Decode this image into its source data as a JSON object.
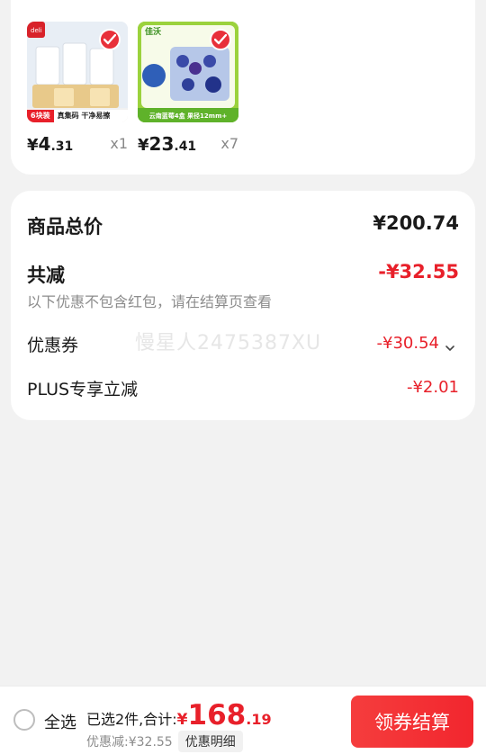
{
  "products": [
    {
      "price_symbol": "¥",
      "price_int": "4",
      "price_dec": ".31",
      "qty": "x1",
      "strip_text": [
        "6块装",
        "真集码 干净易擦"
      ]
    },
    {
      "price_symbol": "¥",
      "price_int": "23",
      "price_dec": ".41",
      "qty": "x7",
      "strip_text": [
        "云南蓝莓4盒 果径12mm+"
      ]
    }
  ],
  "summary": {
    "total_label": "商品总价",
    "total_value": "¥200.74",
    "reduce_label": "共减",
    "reduce_value": "-¥32.55",
    "reduce_note": "以下优惠不包含红包，请在结算页查看",
    "coupon_label": "优惠券",
    "coupon_value": "-¥30.54",
    "plus_label": "PLUS专享立减",
    "plus_value": "-¥2.01",
    "watermark": "慢星人2475387XU"
  },
  "bottom": {
    "select_all": "全选",
    "selected_text": "已选2件,合计:",
    "total_symbol": "¥",
    "total_int": "168",
    "total_dec": ".19",
    "discount_text": "优惠减:¥32.55",
    "detail_label": "优惠明细",
    "checkout_label": "领券结算"
  },
  "colors": {
    "accent_red": "#e8202a",
    "checkout_bg": "#f2262e",
    "page_bg": "#f2f2f2"
  }
}
